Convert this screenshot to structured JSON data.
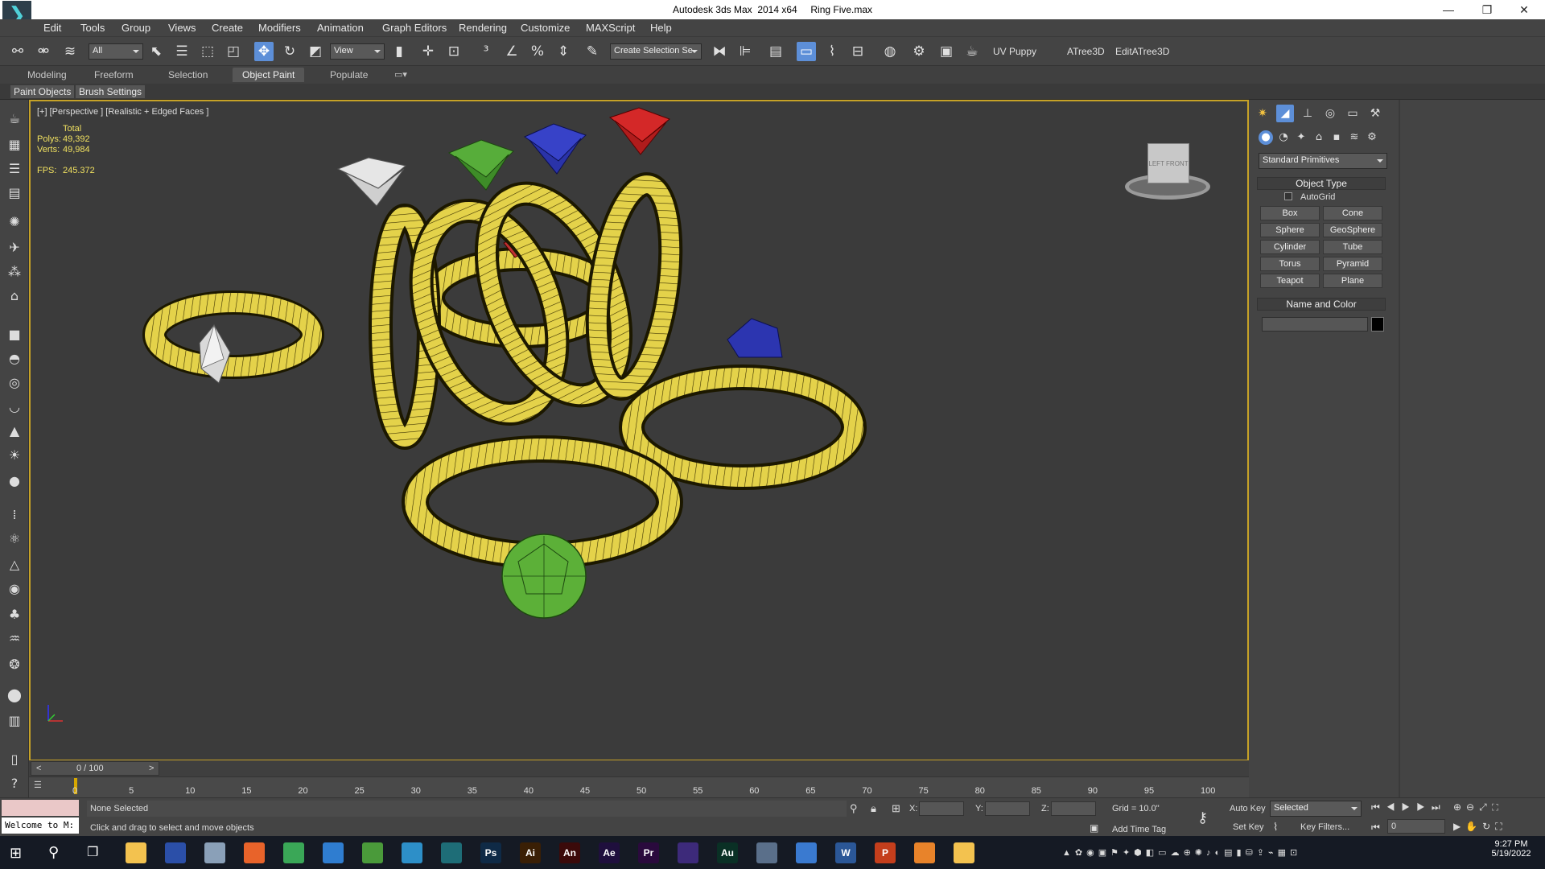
{
  "app": {
    "title": "Autodesk 3ds Max  2014 x64     Ring Five.max",
    "logo": "3ds-max-logo"
  },
  "window_controls": {
    "minimize": "—",
    "restore": "❐",
    "close": "✕"
  },
  "menu": [
    "Edit",
    "Tools",
    "Group",
    "Views",
    "Create",
    "Modifiers",
    "Animation",
    "Graph Editors",
    "Rendering",
    "Customize",
    "MAXScript",
    "Help"
  ],
  "toolbar": {
    "selection_filter": "All",
    "ref_coord": "View",
    "named_selection": "Create Selection Se",
    "uv_puppy": "UV Puppy",
    "atree": "ATree3D",
    "edit_atree": "EditATree3D"
  },
  "ribbon": {
    "tabs": [
      "Modeling",
      "Freeform",
      "Selection",
      "Object Paint",
      "Populate"
    ],
    "active": "Object Paint",
    "sub_buttons": [
      "Paint Objects",
      "Brush Settings"
    ]
  },
  "viewport": {
    "label": "[+] [Perspective ] [Realistic + Edged Faces ]",
    "stats": {
      "total_label": "Total",
      "polys_label": "Polys:",
      "polys": "49,392",
      "verts_label": "Verts:",
      "verts": "49,984",
      "fps_label": "FPS:",
      "fps": "245.372"
    },
    "viewcube": {
      "left": "LEFT",
      "front": "FRONT"
    },
    "border_color": "#c6a227"
  },
  "command_panel": {
    "category": "Standard Primitives",
    "object_type_title": "Object Type",
    "autogrid": "AutoGrid",
    "buttons": [
      "Box",
      "Cone",
      "Sphere",
      "GeoSphere",
      "Cylinder",
      "Tube",
      "Torus",
      "Pyramid",
      "Teapot",
      "Plane"
    ],
    "name_color_title": "Name and Color"
  },
  "timeline": {
    "frame": "0 / 100",
    "ticks": [
      "0",
      "5",
      "10",
      "15",
      "20",
      "25",
      "30",
      "35",
      "40",
      "45",
      "50",
      "55",
      "60",
      "65",
      "70",
      "75",
      "80",
      "85",
      "90",
      "95",
      "100"
    ]
  },
  "status": {
    "maxscript_listener": "Welcome to M:",
    "selection": "None Selected",
    "prompt": "Click and drag to select and move objects",
    "x_label": "X:",
    "y_label": "Y:",
    "z_label": "Z:",
    "grid": "Grid = 10.0\"",
    "auto_key": "Auto Key",
    "key_mode": "Selected",
    "set_key": "Set Key",
    "key_filters": "Key Filters...",
    "add_time_tag": "Add Time Tag",
    "current_frame": "0"
  },
  "taskbar": {
    "time": "9:27 PM",
    "date": "5/19/2022",
    "apps": [
      {
        "name": "file-explorer-icon",
        "label": "",
        "color": "#f3c24f"
      },
      {
        "name": "3dsmax-blue-icon",
        "label": "",
        "color": "#2b4fa8"
      },
      {
        "name": "paint-icon",
        "label": "",
        "color": "#8aa0b8"
      },
      {
        "name": "firefox-icon",
        "label": "",
        "color": "#e8632a"
      },
      {
        "name": "chrome-icon",
        "label": "",
        "color": "#3aa757"
      },
      {
        "name": "search-app-icon",
        "label": "",
        "color": "#2f7dd0"
      },
      {
        "name": "globe-icon",
        "label": "",
        "color": "#4a9a3a"
      },
      {
        "name": "earth-icon",
        "label": "",
        "color": "#2d8fc8"
      },
      {
        "name": "3dsmax-icon",
        "label": "",
        "color": "#1e6d77"
      },
      {
        "name": "photoshop-icon",
        "label": "Ps",
        "color": "#0f2a46"
      },
      {
        "name": "illustrator-icon",
        "label": "Ai",
        "color": "#3a1f05"
      },
      {
        "name": "animate-icon",
        "label": "An",
        "color": "#3b0a0a"
      },
      {
        "name": "after-effects-icon",
        "label": "Ae",
        "color": "#1f0f3d"
      },
      {
        "name": "premiere-icon",
        "label": "Pr",
        "color": "#2a0a3d"
      },
      {
        "name": "mudbox-icon",
        "label": "",
        "color": "#3d2a7a"
      },
      {
        "name": "audition-icon",
        "label": "Au",
        "color": "#0a3025"
      },
      {
        "name": "monitor-icon",
        "label": "",
        "color": "#5a6f8a"
      },
      {
        "name": "camera-app-icon",
        "label": "",
        "color": "#3a7ad0"
      },
      {
        "name": "word-icon",
        "label": "W",
        "color": "#2b5797"
      },
      {
        "name": "powerpoint-icon",
        "label": "P",
        "color": "#c43e1c"
      },
      {
        "name": "sublime-icon",
        "label": "",
        "color": "#e8832a"
      },
      {
        "name": "folder-icon",
        "label": "",
        "color": "#f3c24f"
      }
    ]
  }
}
